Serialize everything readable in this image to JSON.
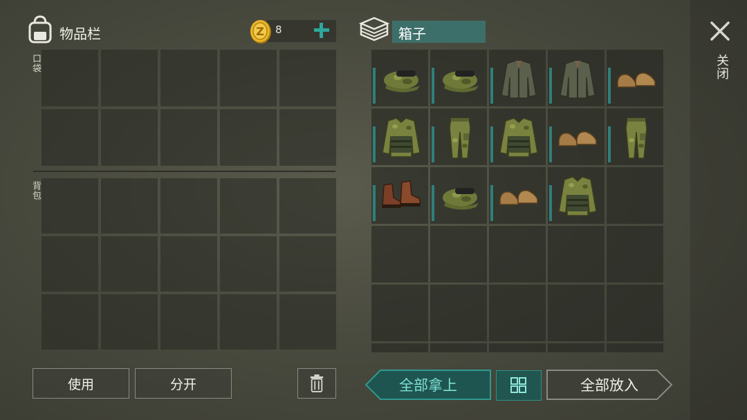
{
  "inventory": {
    "title": "物品栏",
    "coins": "8",
    "pocket_label": "口袋",
    "backpack_label": "背包"
  },
  "container": {
    "title": "箱子",
    "items": [
      "camo-cap-icon",
      "camo-cap-icon",
      "jacket-icon",
      "jacket-icon",
      "shoes-icon",
      "camo-vest-icon",
      "camo-pants-icon",
      "camo-vest-icon",
      "shoes-icon",
      "camo-pants-icon",
      "boots-icon",
      "camo-cap-icon",
      "shoes-icon",
      "camo-vest-icon",
      "",
      "",
      "",
      "",
      "",
      "",
      "",
      "",
      "",
      "",
      "",
      "",
      "",
      "",
      "",
      ""
    ]
  },
  "buttons": {
    "use": "使用",
    "split": "分开",
    "take_all": "全部拿上",
    "put_all": "全部放入"
  },
  "close_label": "关闭",
  "colors": {
    "accent": "#2f8f86",
    "title_bar": "#3d6f6a",
    "take_all_fill": "#1f5550"
  }
}
